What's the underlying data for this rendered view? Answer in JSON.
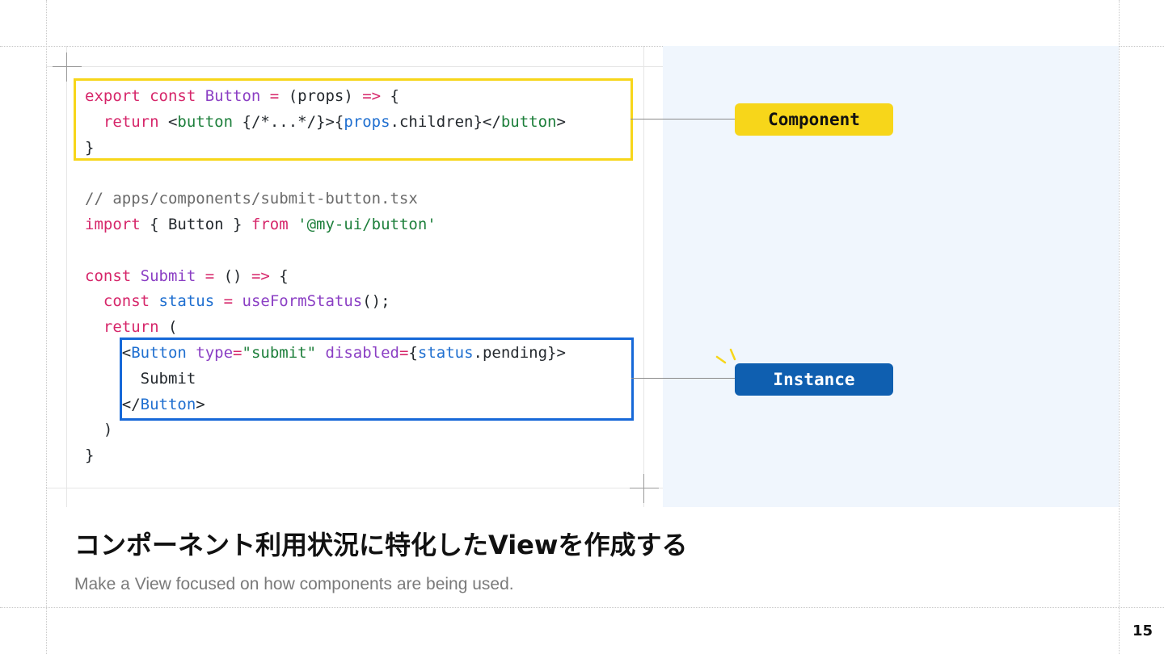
{
  "slide": {
    "code_lines": [
      [
        [
          "k",
          "export "
        ],
        [
          "k",
          "const "
        ],
        [
          "n",
          "Button "
        ],
        [
          "k",
          "= "
        ],
        [
          "p",
          "(props) "
        ],
        [
          "k",
          "=> "
        ],
        [
          "p",
          "{"
        ]
      ],
      [
        [
          "p",
          "  "
        ],
        [
          "k",
          "return "
        ],
        [
          "p",
          "<"
        ],
        [
          "t",
          "button "
        ],
        [
          "p",
          "{/*...*/}>{"
        ],
        [
          "v",
          "props"
        ],
        [
          "p",
          ".children}</"
        ],
        [
          "t",
          "button"
        ],
        [
          "p",
          ">"
        ]
      ],
      [
        [
          "p",
          "}"
        ]
      ],
      [],
      [
        [
          "c",
          "// apps/components/submit-button.tsx"
        ]
      ],
      [
        [
          "k",
          "import "
        ],
        [
          "p",
          "{ Button } "
        ],
        [
          "k",
          "from "
        ],
        [
          "t",
          "'@my-ui/button'"
        ]
      ],
      [],
      [
        [
          "k",
          "const "
        ],
        [
          "n",
          "Submit "
        ],
        [
          "k",
          "= "
        ],
        [
          "p",
          "() "
        ],
        [
          "k",
          "=> "
        ],
        [
          "p",
          "{"
        ]
      ],
      [
        [
          "p",
          "  "
        ],
        [
          "k",
          "const "
        ],
        [
          "v",
          "status "
        ],
        [
          "k",
          "= "
        ],
        [
          "n",
          "useFormStatus"
        ],
        [
          "p",
          "();"
        ]
      ],
      [
        [
          "p",
          "  "
        ],
        [
          "k",
          "return "
        ],
        [
          "p",
          "("
        ]
      ],
      [
        [
          "p",
          "    <"
        ],
        [
          "v",
          "Button "
        ],
        [
          "n",
          "type"
        ],
        [
          "k",
          "="
        ],
        [
          "t",
          "\"submit\" "
        ],
        [
          "n",
          "disabled"
        ],
        [
          "k",
          "="
        ],
        [
          "p",
          "{"
        ],
        [
          "v",
          "status"
        ],
        [
          "p",
          ".pending}>"
        ]
      ],
      [
        [
          "p",
          "      Submit"
        ]
      ],
      [
        [
          "p",
          "    </"
        ],
        [
          "v",
          "Button"
        ],
        [
          "p",
          ">"
        ]
      ],
      [
        [
          "p",
          "  )"
        ]
      ],
      [
        [
          "p",
          "}"
        ]
      ]
    ],
    "labels": {
      "component": "Component",
      "instance": "Instance"
    },
    "headline": "コンポーネント利用状況に特化したViewを作成する",
    "subheadline": "Make a View focused on how components are being used.",
    "page_number": "15"
  },
  "colors": {
    "keyword": "#d6266a",
    "identifier": "#8b3fc4",
    "string_tag": "#1d7f3b",
    "variable": "#1f6fd0",
    "comment": "#6a6a6a",
    "component_highlight": "#f7d61a",
    "instance_highlight": "#1668d8",
    "instance_label_bg": "#0f5fb0",
    "panel_bg": "#f0f6fd"
  },
  "icons": {
    "sparkle": "sparkle-icon",
    "crosshair": "crosshair-icon"
  }
}
